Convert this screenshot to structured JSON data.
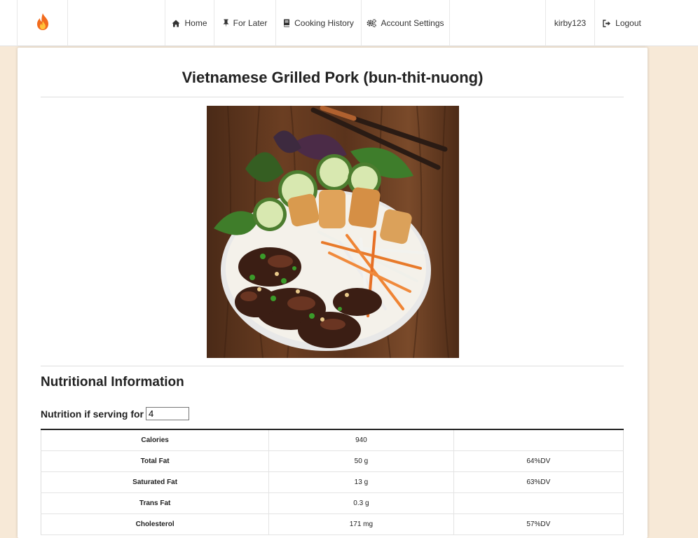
{
  "nav": {
    "brand_icon": "fire-icon",
    "items": [
      {
        "label": "Home",
        "icon": "home-icon"
      },
      {
        "label": "For Later",
        "icon": "pin-icon"
      },
      {
        "label": "Cooking History",
        "icon": "book-icon"
      },
      {
        "label": "Account Settings",
        "icon": "gears-icon"
      }
    ],
    "username": "kirby123",
    "logout_label": "Logout",
    "logout_icon": "logout-icon"
  },
  "recipe": {
    "title": "Vietnamese Grilled Pork (bun-thit-nuong)"
  },
  "nutrition": {
    "heading": "Nutritional Information",
    "serving_label": "Nutrition if serving for",
    "serving_value": "4",
    "rows": [
      {
        "label": "Calories",
        "amount": "940",
        "dv": ""
      },
      {
        "label": "Total Fat",
        "amount": "50 g",
        "dv": "64%DV"
      },
      {
        "label": "Saturated Fat",
        "amount": "13 g",
        "dv": "63%DV"
      },
      {
        "label": "Trans Fat",
        "amount": "0.3 g",
        "dv": ""
      },
      {
        "label": "Cholesterol",
        "amount": "171 mg",
        "dv": "57%DV"
      }
    ]
  },
  "colors": {
    "page_background": "#f7e9d7",
    "card": "#ffffff",
    "brand_flame": "#f26b1d"
  }
}
